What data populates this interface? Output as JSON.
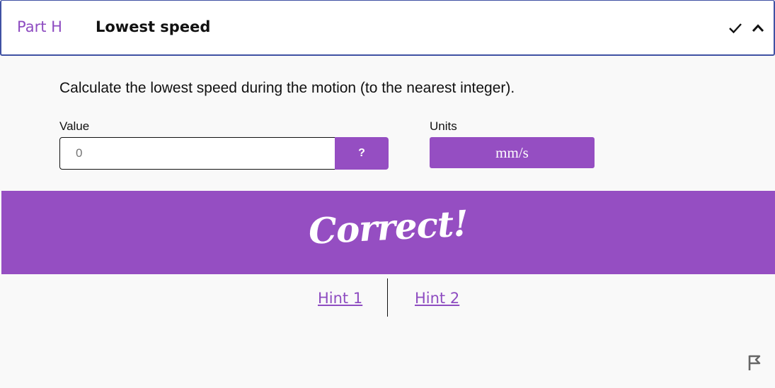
{
  "header": {
    "part_label": "Part H",
    "title": "Lowest speed",
    "icons": [
      "check-icon",
      "chevron-up-icon"
    ]
  },
  "question": {
    "text": "Calculate the lowest speed during the motion (to the nearest integer)."
  },
  "answer": {
    "value_label": "Value",
    "value_placeholder": "0",
    "help_label": "?",
    "units_label": "Units",
    "units_value": "mm/s"
  },
  "feedback": {
    "text": "Correct!"
  },
  "hints": [
    {
      "label": "Hint 1"
    },
    {
      "label": "Hint 2"
    }
  ],
  "footer": {
    "icons": [
      "flag-icon"
    ]
  },
  "colors": {
    "accent": "#954ec2",
    "header_border": "#3f51a3",
    "background": "#f9f9f9"
  }
}
